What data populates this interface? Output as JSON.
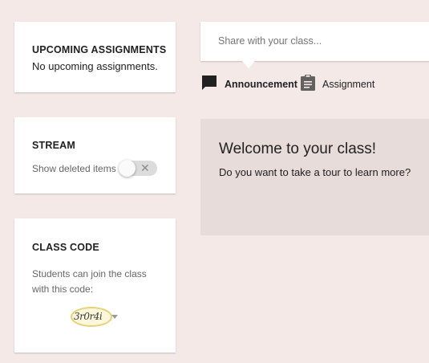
{
  "upcoming": {
    "title": "UPCOMING ASSIGNMENTS",
    "body": "No upcoming assignments."
  },
  "stream": {
    "title": "STREAM",
    "toggle_label": "Show deleted items",
    "toggle_on": false,
    "toggle_icon": "close-icon"
  },
  "class_code": {
    "title": "CLASS CODE",
    "description": "Students can join the class with this code:",
    "code": "3r0r4i"
  },
  "share": {
    "placeholder": "Share with your class..."
  },
  "post_actions": {
    "announcement_label": "Announcement",
    "announcement_icon": "comment-icon",
    "assignment_label": "Assignment",
    "assignment_icon": "clipboard-icon"
  },
  "welcome": {
    "title": "Welcome to your class!",
    "subtitle": "Do you want to take a tour to learn more?"
  },
  "colors": {
    "page_background": "#f5e9e8",
    "welcome_background": "#e8dcdb",
    "code_highlight": "#e6d27a"
  }
}
